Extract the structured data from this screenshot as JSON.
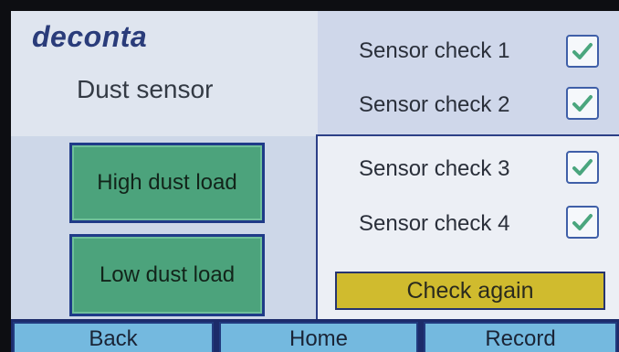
{
  "header": {
    "brand": "deconta",
    "title": "Dust sensor"
  },
  "load_buttons": {
    "high": "High dust load",
    "low": "Low dust load"
  },
  "sensor_checks": [
    {
      "label": "Sensor check 1",
      "checked": true
    },
    {
      "label": "Sensor check 2",
      "checked": true
    },
    {
      "label": "Sensor check 3",
      "checked": true
    },
    {
      "label": "Sensor check 4",
      "checked": true
    }
  ],
  "actions": {
    "check_again": "Check again"
  },
  "nav": {
    "back": "Back",
    "home": "Home",
    "record": "Record"
  },
  "colors": {
    "brand": "#2a3c7a",
    "green_button": "#4ca37c",
    "check_mark": "#4aa67e",
    "check_again": "#d0bb2e",
    "nav_button": "#74b9df"
  }
}
